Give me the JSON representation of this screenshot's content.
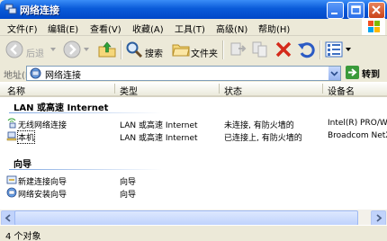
{
  "window": {
    "title": "网络连接"
  },
  "menu": [
    "文件(F)",
    "编辑(E)",
    "查看(V)",
    "收藏(A)",
    "工具(T)",
    "高级(N)",
    "帮助(H)"
  ],
  "toolbar": {
    "back": "后退",
    "search": "搜索",
    "folders": "文件夹"
  },
  "address": {
    "label": "地址(D)",
    "value": "网络连接",
    "go": "转到"
  },
  "columns": [
    "名称",
    "类型",
    "状态",
    "设备名"
  ],
  "groups": [
    {
      "title": "LAN 或高速 Internet",
      "rows": [
        {
          "name": "无线网络连接",
          "type": "LAN 或高速 Internet",
          "status": "未连接, 有防火墙的",
          "device": "Intel(R) PRO/W"
        },
        {
          "name": "本机",
          "type": "LAN 或高速 Internet",
          "status": "已连接上, 有防火墙的",
          "device": "Broadcom NetX"
        }
      ]
    },
    {
      "title": "向导",
      "rows": [
        {
          "name": "新建连接向导",
          "type": "向导"
        },
        {
          "name": "网络安装向导",
          "type": "向导"
        }
      ]
    }
  ],
  "status": {
    "text": "4 个对象"
  },
  "icons": [
    "network-connections-icon",
    "minimize-icon",
    "maximize-icon",
    "close-icon",
    "windows-logo-icon",
    "back-icon",
    "forward-icon",
    "up-folder-icon",
    "search-icon",
    "folder-icon",
    "move-to-icon",
    "copy-to-icon",
    "delete-icon",
    "undo-icon",
    "views-icon",
    "go-arrow-icon",
    "wireless-icon",
    "lan-icon",
    "new-connection-wizard-icon",
    "network-setup-wizard-icon"
  ]
}
